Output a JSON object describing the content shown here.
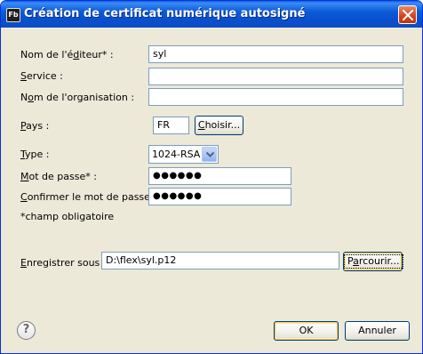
{
  "window": {
    "title": "Création de certificat numérique autosigné",
    "app_icon_text": "Fb"
  },
  "form": {
    "publisher": {
      "label_mn": "d",
      "label": "Nom de l'é",
      "label_mid": "d",
      "label_after": "iteur* :",
      "value": "syl"
    },
    "service": {
      "label_mn": "S",
      "label_rest": "ervice :",
      "value": ""
    },
    "organization": {
      "label_pre": "N",
      "label_mn": "o",
      "label_rest": "m de l'organisation :",
      "value": ""
    },
    "country": {
      "label_mn": "P",
      "label_rest": "ays :",
      "value": "FR",
      "button_mn": "C",
      "button_rest": "hoisir..."
    },
    "type": {
      "label_mn": "T",
      "label_rest": "ype :",
      "value": "1024-RSA"
    },
    "password": {
      "label_mn": "M",
      "label_rest": "ot de passe* :",
      "value": "●●●●●●"
    },
    "confirm": {
      "label_mn": "C",
      "label_rest": "onfirmer le mot de passe* :",
      "value": "●●●●●●"
    },
    "required_note": "*champ obligatoire",
    "save_as": {
      "label_mn": "E",
      "label_rest": "nregistrer sous :",
      "value": "D:\\flex\\syl.p12",
      "button_pre": "P",
      "button_mn": "a",
      "button_rest": "rcourir..."
    }
  },
  "footer": {
    "help_symbol": "?",
    "ok_label": "OK",
    "cancel_label": "Annuler"
  }
}
